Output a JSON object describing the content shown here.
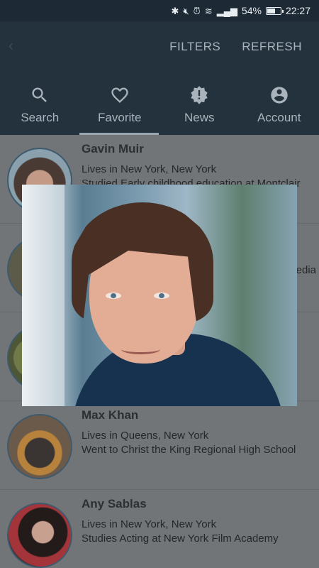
{
  "status_bar": {
    "battery": "54%",
    "battery_level": 0.54,
    "time": "22:27",
    "icons": [
      "bluetooth-icon",
      "mute-icon",
      "alarm-icon",
      "wifi-icon",
      "signal-icon",
      "battery-icon"
    ]
  },
  "app_bar": {
    "actions": [
      {
        "label": "FILTERS"
      },
      {
        "label": "REFRESH"
      }
    ],
    "tabs": [
      {
        "label": "Search",
        "icon": "search-icon"
      },
      {
        "label": "Favorite",
        "icon": "heart-icon"
      },
      {
        "label": "News",
        "icon": "alert-badge-icon"
      },
      {
        "label": "Account",
        "icon": "account-icon"
      }
    ],
    "selected_tab": "Favorite"
  },
  "list": {
    "items": [
      {
        "name": "Gavin Muir",
        "line1": "Lives in New York, New York",
        "line2": "Studied Early childhood education at Montclair"
      },
      {
        "name": "",
        "line1": "",
        "line2": "",
        "edge_text": "edia"
      },
      {
        "name": "",
        "line1": "",
        "line2": ""
      },
      {
        "name": "Max Khan",
        "line1": "Lives in Queens, New York",
        "line2": "Went to Christ the King Regional High School"
      },
      {
        "name": "Any Sablas",
        "line1": "Lives in New York, New York",
        "line2": "Studies Acting at New York Film Academy"
      }
    ]
  },
  "colors": {
    "status_bar": "#1d2a35",
    "app_bar": "#24323e",
    "scrim_list": "#727577",
    "avatar_border": "#3e5a6e"
  }
}
